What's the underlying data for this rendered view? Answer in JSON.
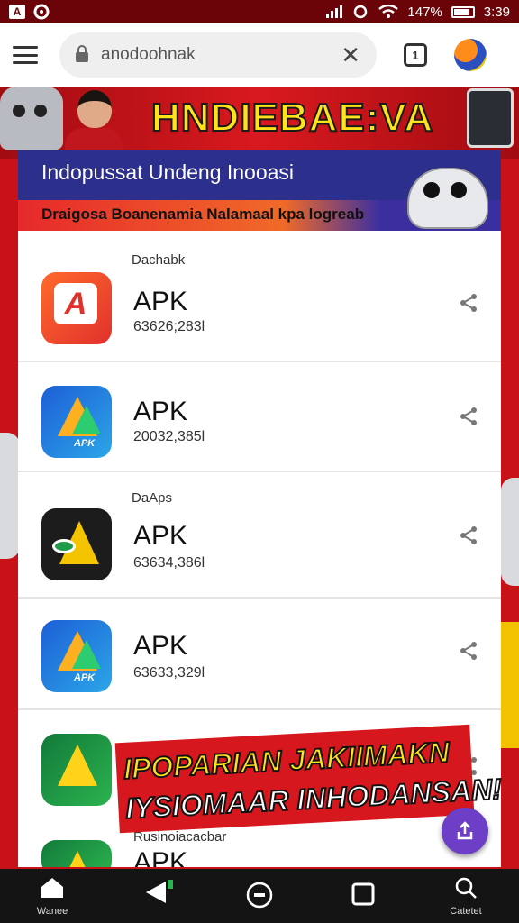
{
  "status_bar": {
    "signal": "all",
    "battery_percent": "147%",
    "time": "3:39"
  },
  "browser": {
    "url": "anodoohnak"
  },
  "hero": {
    "title": "HNDIEBAE:VA"
  },
  "card": {
    "heading": "Indopussat Undeng Inooasi",
    "subheading": "Draigosa Boanenamia Nalamaal kpa logreab"
  },
  "apps": {
    "section_1_label": "Dachabk",
    "section_2_label": "DaAps",
    "section_3_label": "Rusinoiacacbar",
    "items": [
      {
        "name": "APK",
        "version": "63626;283l"
      },
      {
        "name": "APK",
        "version": "20032,385l"
      },
      {
        "name": "APK",
        "version": "63634,386l"
      },
      {
        "name": "APK",
        "version": "63633,329l"
      },
      {
        "name": "APK",
        "version": ""
      }
    ]
  },
  "promo": {
    "line1": "IPOPARIAN JAKIIMAKN",
    "line2": "IYSIOMAAR INHODANSAN!"
  },
  "nav": {
    "home_label": "Wanee",
    "search_label": "Catetet"
  }
}
